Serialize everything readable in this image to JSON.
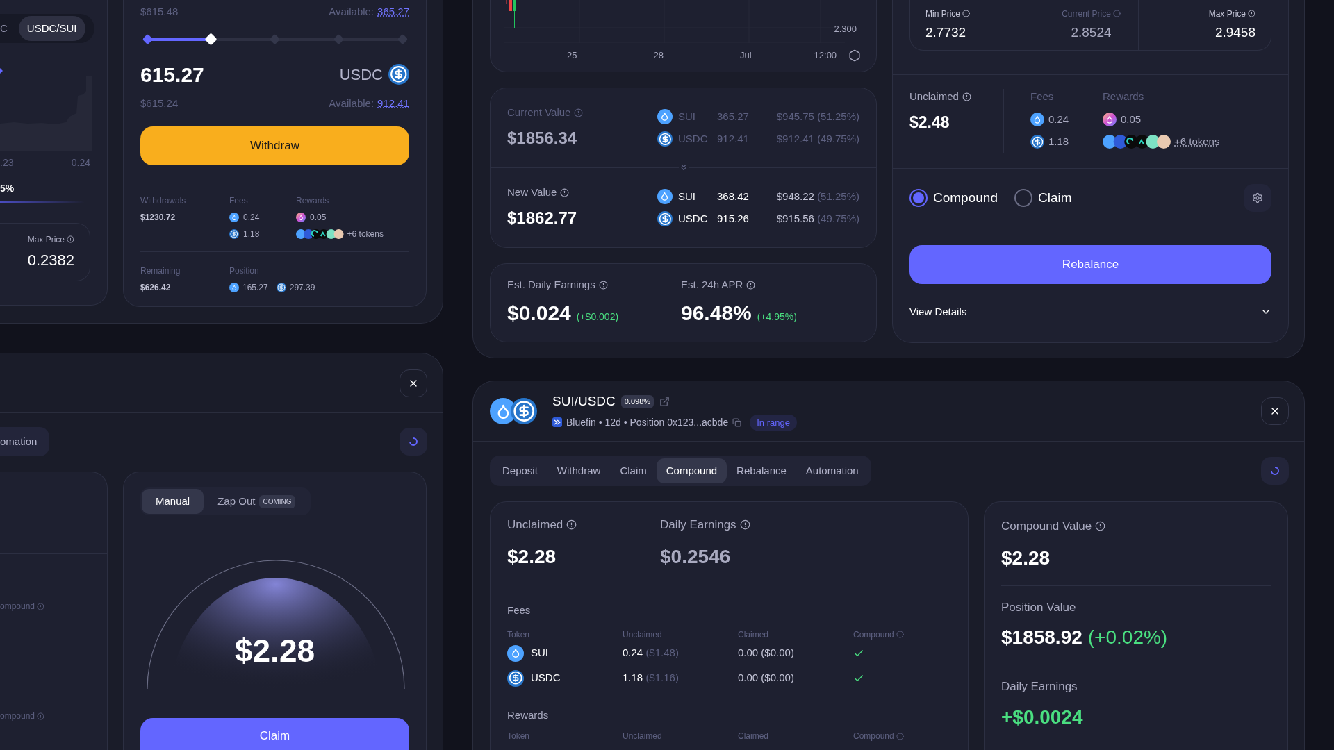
{
  "withdraw_window": {
    "pair_toggle": [
      {
        "label": "C",
        "selected": false
      },
      {
        "label": "USDC/SUI",
        "selected": true
      }
    ],
    "liquidity_axis": [
      ".23",
      "0.24"
    ],
    "range_share": "5%",
    "max_price": {
      "label": "Max Price",
      "value": "0.2382"
    },
    "input_a": {
      "usd": "$615.48",
      "available_label": "Available:",
      "available": "365.27"
    },
    "slider": {
      "level": 0.25
    },
    "input_b": {
      "amount": "615.27",
      "token": "USDC",
      "usd": "$615.24",
      "available_label": "Available:",
      "available": "912.41"
    },
    "withdraw_button": "Withdraw",
    "summary": {
      "withdrawals": {
        "label": "Withdrawals",
        "value": "$1230.72"
      },
      "fees": {
        "label": "Fees",
        "items": [
          {
            "kind": "sui",
            "value": "0.24"
          },
          {
            "kind": "usdc",
            "value": "1.18"
          }
        ]
      },
      "rewards": {
        "label": "Rewards",
        "items": [
          {
            "kind": "sui-gradient",
            "value": "0.05"
          }
        ],
        "more": "+6 tokens"
      },
      "remaining": {
        "label": "Remaining",
        "value": "$626.42"
      },
      "position": {
        "label": "Position",
        "items": [
          {
            "kind": "sui",
            "value": "165.27"
          },
          {
            "kind": "usdc",
            "value": "297.39"
          }
        ]
      }
    }
  },
  "claim_window": {
    "tab": {
      "label": "omation",
      "selected": false
    },
    "setting_labels": [
      "ompound",
      "ompound"
    ],
    "modes": [
      {
        "label": "Manual",
        "selected": true
      },
      {
        "label": "Zap Out",
        "badge": "COMING",
        "selected": false
      }
    ],
    "amount": "$2.28",
    "claim_button": "Claim"
  },
  "rebalance_window": {
    "price_chart": {
      "y_labels": [
        "2.300"
      ],
      "x_labels": [
        "25",
        "28",
        "Jul",
        "12:00"
      ]
    },
    "values": [
      {
        "label": "Current Value",
        "muted": true,
        "total": "$1856.34",
        "tokens": [
          {
            "kind": "sui",
            "symbol": "SUI",
            "amount": "365.27",
            "value": "$945.75",
            "share": "(51.25%)"
          },
          {
            "kind": "usdc",
            "symbol": "USDC",
            "amount": "912.41",
            "value": "$912.41",
            "share": "(49.75%)"
          }
        ]
      },
      {
        "label": "New Value",
        "muted": false,
        "total": "$1862.77",
        "tokens": [
          {
            "kind": "sui",
            "symbol": "SUI",
            "amount": "368.42",
            "value": "$948.22",
            "share": "(51.25%)"
          },
          {
            "kind": "usdc",
            "symbol": "USDC",
            "amount": "915.26",
            "value": "$915.56",
            "share": "(49.75%)"
          }
        ]
      }
    ],
    "earnings": [
      {
        "label": "Est. Daily Earnings",
        "value": "$0.024",
        "change": "(+$0.002)"
      },
      {
        "label": "Est. 24h APR",
        "value": "96.48%",
        "change": "(+4.95%)"
      }
    ],
    "price_range": [
      {
        "label": "Min Price",
        "value": "2.7732",
        "muted": false
      },
      {
        "label": "Current Price",
        "value": "2.8524",
        "muted": true
      },
      {
        "label": "Max Price",
        "value": "2.9458",
        "muted": false
      }
    ],
    "unclaimed": {
      "label": "Unclaimed",
      "value": "$2.48"
    },
    "fees": {
      "label": "Fees",
      "items": [
        {
          "kind": "sui",
          "value": "0.24"
        },
        {
          "kind": "usdc",
          "value": "1.18"
        }
      ]
    },
    "rewards": {
      "label": "Rewards",
      "items": [
        {
          "kind": "sui-gradient",
          "value": "0.05"
        }
      ],
      "more": "+6 tokens"
    },
    "options": [
      {
        "label": "Compound",
        "selected": true
      },
      {
        "label": "Claim",
        "selected": false
      }
    ],
    "rebalance_button": "Rebalance",
    "details": {
      "label": "View Details",
      "expanded": false
    }
  },
  "position_window": {
    "pair": "SUI/USDC",
    "fee_tier": "0.098%",
    "subtitle": "Bluefin • 12d • Position 0x123...acbde",
    "status": "In range",
    "tabs": [
      {
        "label": "Deposit",
        "selected": false
      },
      {
        "label": "Withdraw",
        "selected": false
      },
      {
        "label": "Claim",
        "selected": false
      },
      {
        "label": "Compound",
        "selected": true
      },
      {
        "label": "Rebalance",
        "selected": false
      },
      {
        "label": "Automation",
        "selected": false
      }
    ],
    "stats": [
      {
        "label": "Unclaimed",
        "value": "$2.28",
        "muted": false
      },
      {
        "label": "Daily Earnings",
        "value": "$0.2546",
        "muted": true
      }
    ],
    "fees": {
      "title": "Fees",
      "columns": [
        "Token",
        "Unclaimed",
        "Claimed",
        "Compound"
      ],
      "rows": [
        {
          "kind": "sui",
          "token": "SUI",
          "unclaimed": "0.24",
          "unclaimed_usd": "($1.48)",
          "claimed": "0.00 ($0.00)",
          "compound": true
        },
        {
          "kind": "usdc",
          "token": "USDC",
          "unclaimed": "1.18",
          "unclaimed_usd": "($1.16)",
          "claimed": "0.00 ($0.00)",
          "compound": true
        }
      ]
    },
    "rewards": {
      "title": "Rewards",
      "columns": [
        "Token",
        "Unclaimed",
        "Claimed",
        "Compound"
      ]
    },
    "compound_value": {
      "label": "Compound Value",
      "value": "$2.28"
    },
    "position_value": {
      "label": "Position Value",
      "value": "$1858.92",
      "change": "(+0.02%)"
    },
    "daily_earnings": {
      "label": "Daily Earnings",
      "value": "+$0.0024"
    }
  }
}
